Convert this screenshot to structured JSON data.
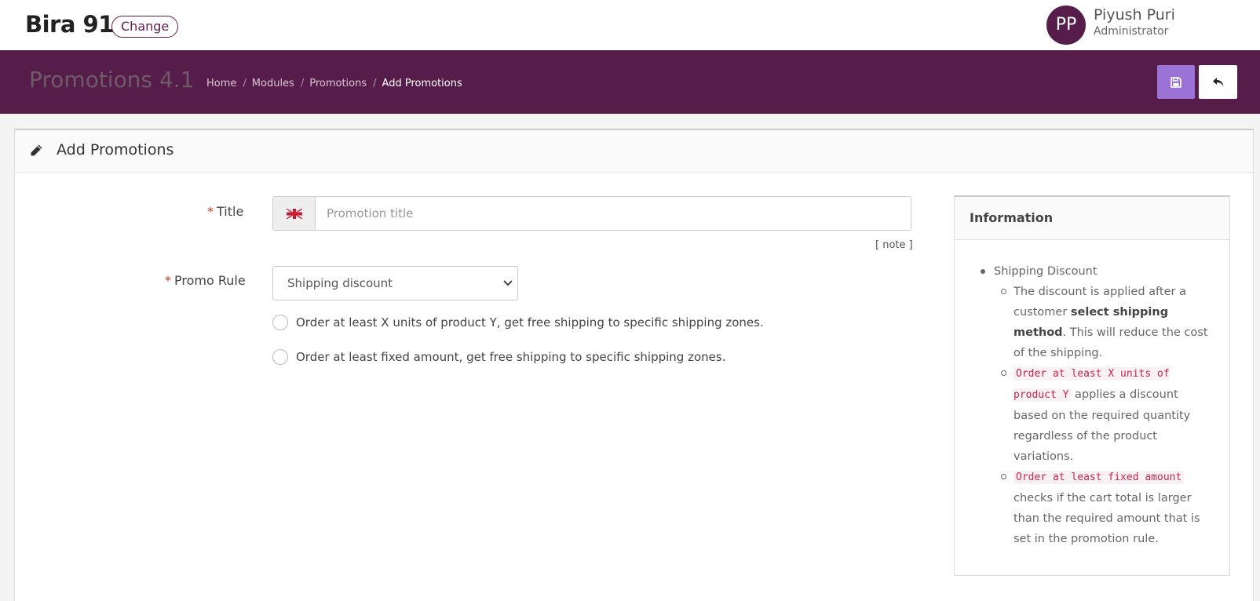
{
  "topbar": {
    "brand": "Bira 91",
    "change_label": "Change",
    "avatar_initials": "PP",
    "user_name": "Piyush Puri",
    "user_role": "Administrator"
  },
  "header": {
    "module_title": "Promotions 4.1",
    "breadcrumb": [
      "Home",
      "Modules",
      "Promotions",
      "Add Promotions"
    ]
  },
  "panel": {
    "title": "Add Promotions"
  },
  "form": {
    "title_label": "Title",
    "title_placeholder": "Promotion title",
    "title_value": "",
    "note": "[ note ]",
    "promo_rule_label": "Promo Rule",
    "promo_rule_selected": "Shipping discount",
    "radio_options": [
      "Order at least X units of product Y, get free shipping to specific shipping zones.",
      "Order at least fixed amount, get free shipping to specific shipping zones."
    ]
  },
  "info": {
    "title": "Information",
    "heading_item": "Shipping Discount",
    "item1_a": "The discount is applied after a customer ",
    "item1_bold": "select shipping method",
    "item1_b": ". This will reduce the cost of the shipping.",
    "item2_code": "Order at least X units of product Y",
    "item2_text": " applies a discount based on the required quantity regardless of the product variations.",
    "item3_code": "Order at least fixed amount",
    "item3_text": " checks if the cart total is larger than the required amount that is set in the promotion rule."
  },
  "colors": {
    "brand_purple": "#561d4a",
    "save_button": "#9b72d6"
  },
  "icons": {
    "save": "floppy-disk-icon",
    "back": "reply-arrow-icon",
    "edit": "pencil-icon",
    "flag": "uk-flag-icon",
    "dropdown": "chevron-down-icon"
  }
}
